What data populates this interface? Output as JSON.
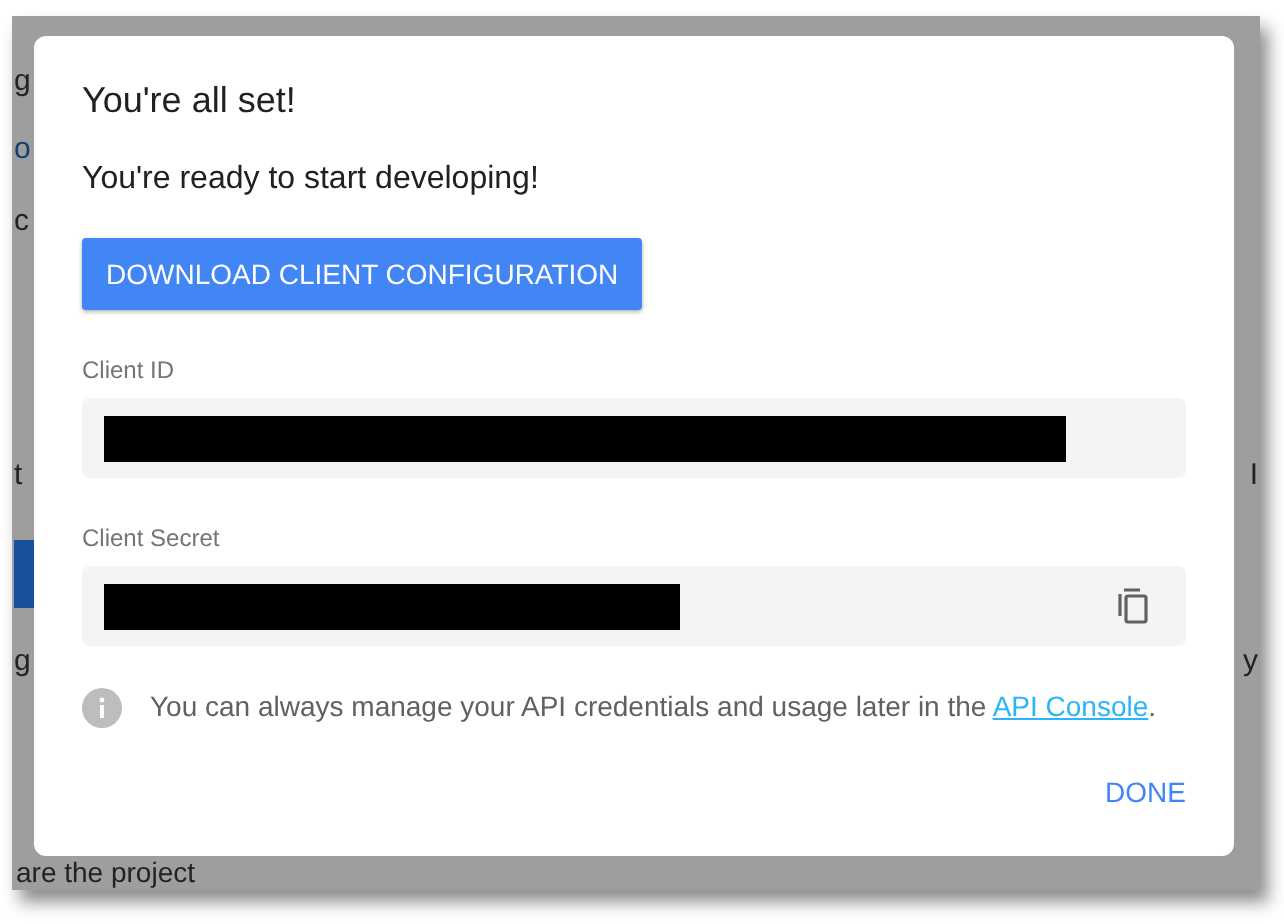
{
  "background_page": {
    "lines": [
      {
        "left": "g",
        "kind": "text"
      },
      {
        "left": "o",
        "kind": "link"
      },
      {
        "left": "c",
        "kind": "text"
      },
      {
        "left": "t",
        "right": "I",
        "kind": "text"
      },
      {
        "kind": "button"
      },
      {
        "left": "g",
        "right": "y",
        "kind": "text"
      }
    ],
    "heading": "are the project"
  },
  "dialog": {
    "title": "You're all set!",
    "message": "You're ready to start developing!",
    "download_button": "DOWNLOAD CLIENT CONFIGURATION",
    "fields": [
      {
        "label": "Client ID",
        "copyable": false
      },
      {
        "label": "Client Secret",
        "copyable": true
      }
    ],
    "info": {
      "text": "You can always manage your API credentials and usage later in the ",
      "link": "API Console",
      "suffix": "."
    },
    "done_button": "DONE"
  }
}
